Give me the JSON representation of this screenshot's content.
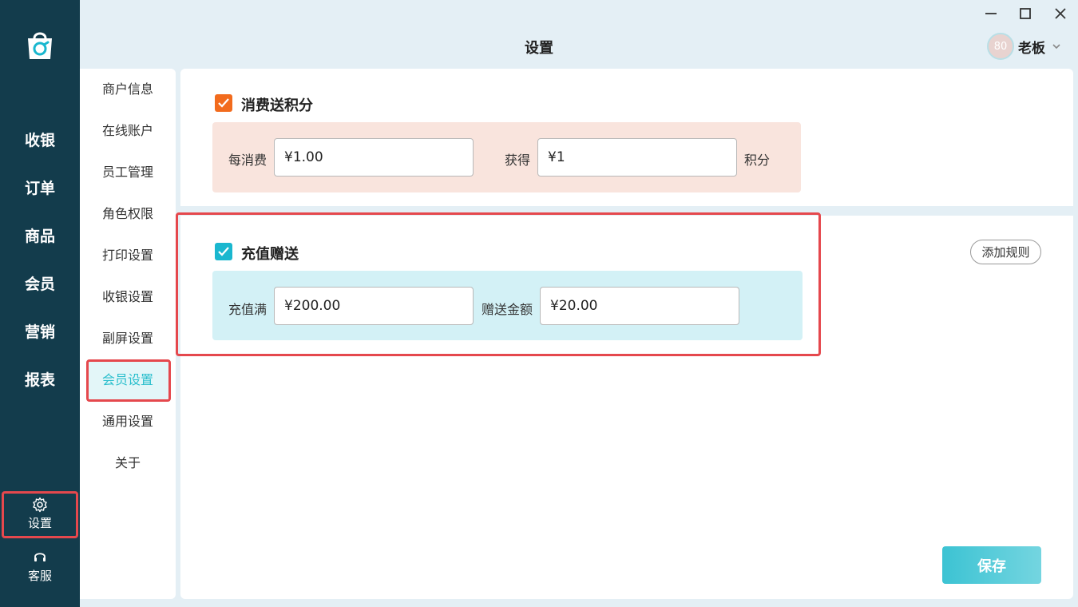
{
  "window": {
    "title": "设置"
  },
  "nav": {
    "items": [
      {
        "label": "收银"
      },
      {
        "label": "订单"
      },
      {
        "label": "商品"
      },
      {
        "label": "会员"
      },
      {
        "label": "营销"
      },
      {
        "label": "报表"
      }
    ],
    "settings_label": "设置",
    "service_label": "客服"
  },
  "user": {
    "avatar_text": "80",
    "name": "老板"
  },
  "submenu": {
    "items": [
      {
        "label": "商户信息"
      },
      {
        "label": "在线账户"
      },
      {
        "label": "员工管理"
      },
      {
        "label": "角色权限"
      },
      {
        "label": "打印设置"
      },
      {
        "label": "收银设置"
      },
      {
        "label": "副屏设置"
      },
      {
        "label": "会员设置",
        "active": true
      },
      {
        "label": "通用设置"
      },
      {
        "label": "关于"
      }
    ]
  },
  "points": {
    "title": "消费送积分",
    "checked": true,
    "spend_label": "每消费",
    "spend_value": "¥1.00",
    "earn_label": "获得",
    "earn_value": "¥1",
    "unit_label": "积分"
  },
  "recharge": {
    "title": "充值赠送",
    "checked": true,
    "add_rule_label": "添加规则",
    "threshold_label": "充值满",
    "threshold_value": "¥200.00",
    "bonus_label": "赠送金额",
    "bonus_value": "¥20.00"
  },
  "actions": {
    "save_label": "保存"
  },
  "colors": {
    "sidebar": "#133c4c",
    "accent": "#2bbfcd",
    "highlight": "#e5484d",
    "checkbox_orange": "#f26b1d",
    "checkbox_teal": "#1ab7cf"
  }
}
